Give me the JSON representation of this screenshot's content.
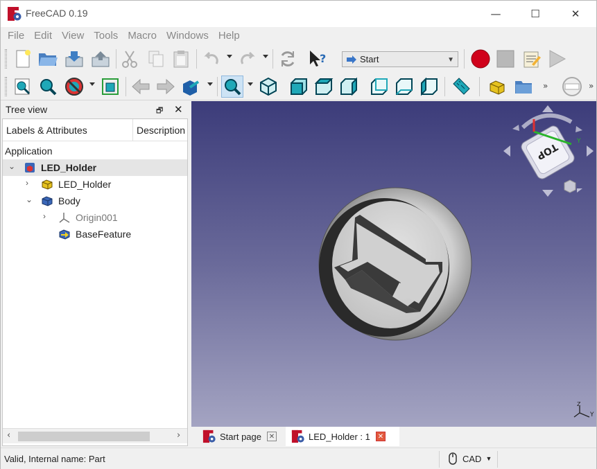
{
  "window": {
    "title": "FreeCAD 0.19",
    "min_symbol": "—",
    "max_symbol": "☐",
    "close_symbol": "✕"
  },
  "menu": [
    "File",
    "Edit",
    "View",
    "Tools",
    "Macro",
    "Windows",
    "Help"
  ],
  "toolbar1": {
    "workbench_selected": "Start"
  },
  "tree_view": {
    "title": "Tree view",
    "col_labels": "Labels & Attributes",
    "col_description": "Description",
    "group": "Application",
    "rows": [
      {
        "label": "LED_Holder",
        "expander": "⌄"
      },
      {
        "label": "LED_Holder",
        "expander": "›"
      },
      {
        "label": "Body",
        "expander": "⌄"
      },
      {
        "label": "Origin001",
        "expander": "›"
      },
      {
        "label": "BaseFeature",
        "expander": ""
      }
    ]
  },
  "navcube": {
    "face": "TOP",
    "y_label": "Y"
  },
  "axis_label": "Y",
  "axis_label_z": "Z",
  "tabs": [
    {
      "label": "Start page",
      "close": "✕"
    },
    {
      "label": "LED_Holder : 1",
      "close": "✕"
    }
  ],
  "status": {
    "text": "Valid, Internal name: Part",
    "nav_style": "CAD"
  },
  "colors": {
    "view_top": "#3c3c7a",
    "view_bottom": "#a4a4c2",
    "accent_teal": "#1fa8b8",
    "record_red": "#d0021b"
  },
  "icons": [
    "new-icon",
    "open-icon",
    "save-icon",
    "saveas-icon",
    "cut-icon",
    "copy-icon",
    "paste-icon",
    "undo-icon",
    "redo-icon",
    "refresh-icon",
    "whatsthis-icon",
    "record-icon",
    "stop-icon",
    "macro-edit-icon",
    "play-icon",
    "fit-all-icon",
    "fit-selection-icon",
    "drawstyle-icon",
    "bounding-box-icon",
    "back-icon",
    "forward-icon",
    "sync-view-icon",
    "zoom-icon",
    "isometric-icon",
    "front-icon",
    "top-icon",
    "right-icon",
    "rear-icon",
    "bottom-icon",
    "left-icon",
    "measure-icon",
    "part-icon",
    "folder-icon"
  ]
}
